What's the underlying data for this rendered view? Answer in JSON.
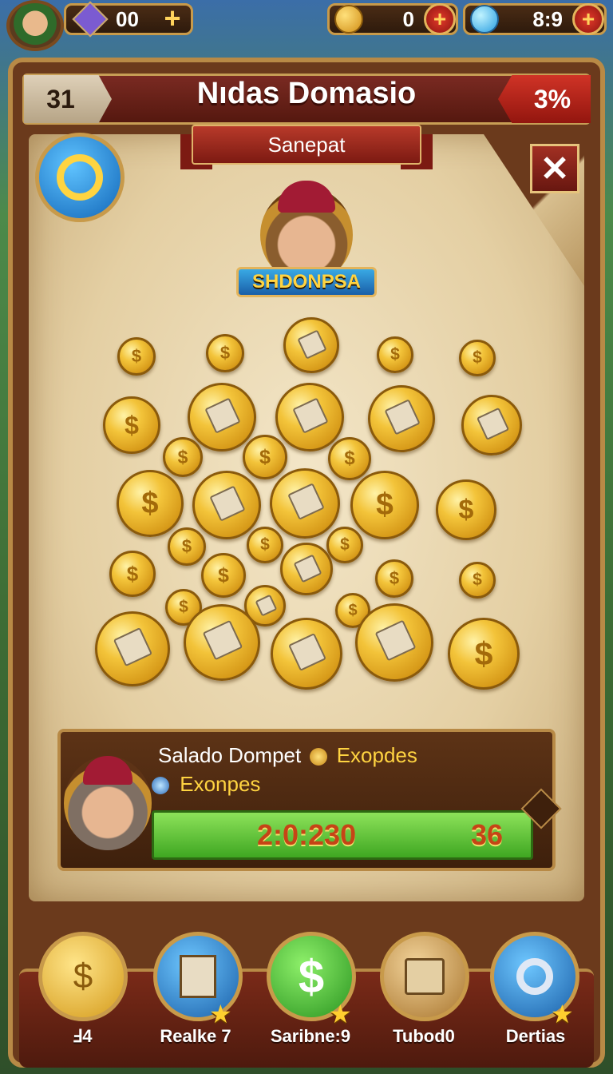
{
  "hud": {
    "gems": "00",
    "gold": "0",
    "crystals": "8:9"
  },
  "board": {
    "title": "Nıdas Domasio",
    "level": "31",
    "percent": "3%",
    "ribbon": "Sanepat",
    "emblem_label": "SHDONPSA"
  },
  "quest": {
    "line1_left": "Salado Dompet",
    "line1_right": "Exopdes",
    "line2": "Exonpes",
    "timer": "2:0:230",
    "count": "36"
  },
  "nav": [
    {
      "label": "Ⅎ4",
      "icon": "coin-tag-icon"
    },
    {
      "label": "Realke 7",
      "icon": "scroll-icon"
    },
    {
      "label": "Saribne:9",
      "icon": "dollar-icon"
    },
    {
      "label": "Tubod0",
      "icon": "chest-icon"
    },
    {
      "label": "Dertias",
      "icon": "refresh-icon"
    }
  ],
  "colors": {
    "accent_gold": "#c89a4a",
    "header_red": "#7a2a22",
    "progress_green": "#5fc43a"
  }
}
